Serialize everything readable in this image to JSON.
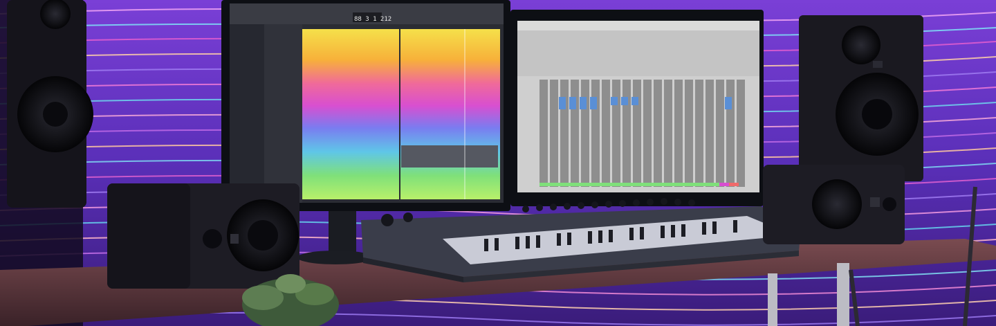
{
  "scene": {
    "description_tags": [
      "studio-photo"
    ],
    "colors": {
      "wall_magenta": "#c23cd8",
      "wall_cyan": "#58d9f0",
      "wall_violet": "#6a3bd1",
      "desk_wood": "#5b3a3a",
      "monitor_frame": "#111318",
      "mixer_bg": "#cfcfcf"
    }
  },
  "left_monitor": {
    "transport_display": "88 3 1 212"
  },
  "right_monitor": {},
  "keyboard": {},
  "speakers": {}
}
